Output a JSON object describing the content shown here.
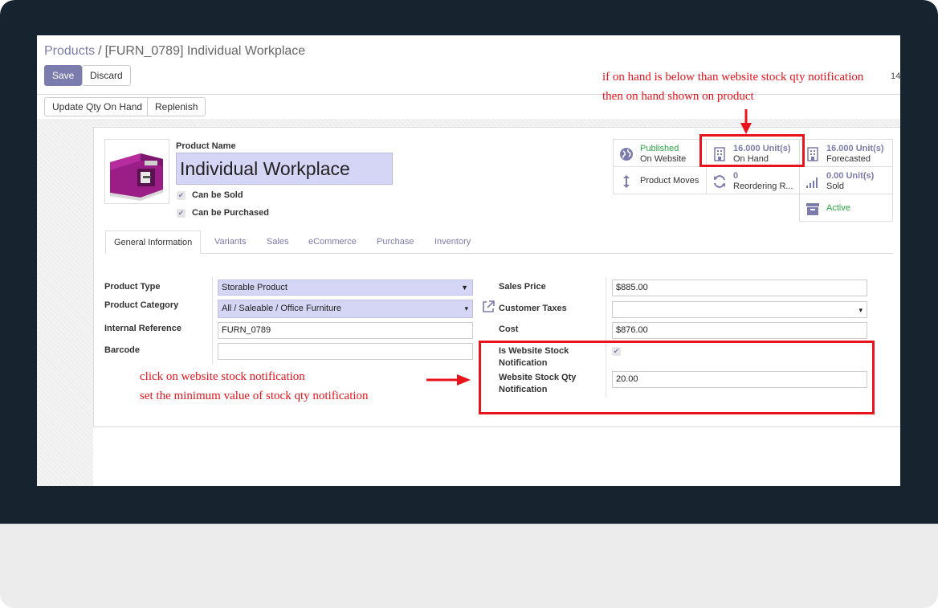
{
  "breadcrumb": {
    "parent": "Products",
    "separator": "/",
    "current": "[FURN_0789] Individual Workplace"
  },
  "toolbar": {
    "save_label": "Save",
    "discard_label": "Discard",
    "pager_fragment": "14"
  },
  "actions": {
    "update_qty_label": "Update Qty On Hand",
    "replenish_label": "Replenish"
  },
  "product": {
    "name_label": "Product Name",
    "name": "Individual Workplace",
    "can_be_sold_label": "Can be Sold",
    "can_be_sold": true,
    "can_be_purchased_label": "Can be Purchased",
    "can_be_purchased": true
  },
  "smart_buttons": {
    "published": {
      "line1": "Published",
      "line2": "On Website",
      "icon": "globe-icon"
    },
    "on_hand": {
      "line1": "16.000 Unit(s)",
      "line2": "On Hand",
      "icon": "building-icon"
    },
    "forecasted": {
      "line1": "16.000 Unit(s)",
      "line2": "Forecasted",
      "icon": "building-icon"
    },
    "product_moves": {
      "label": "Product Moves",
      "icon": "arrows-vertical-icon"
    },
    "reordering": {
      "line1": "0",
      "line2": "Reordering R...",
      "icon": "refresh-icon"
    },
    "sold": {
      "line1": "0.00 Unit(s)",
      "line2": "Sold",
      "icon": "signal-icon"
    },
    "active": {
      "label": "Active",
      "icon": "archive-icon"
    }
  },
  "tabs": [
    {
      "label": "General Information",
      "active": true
    },
    {
      "label": "Variants"
    },
    {
      "label": "Sales"
    },
    {
      "label": "eCommerce"
    },
    {
      "label": "Purchase"
    },
    {
      "label": "Inventory"
    }
  ],
  "left_fields": {
    "product_type": {
      "label": "Product Type",
      "value": "Storable Product"
    },
    "product_category": {
      "label": "Product Category",
      "value": "All / Saleable / Office Furniture"
    },
    "internal_reference": {
      "label": "Internal Reference",
      "value": "FURN_0789"
    },
    "barcode": {
      "label": "Barcode",
      "value": ""
    }
  },
  "right_fields": {
    "sales_price": {
      "label": "Sales Price",
      "value": "$885.00"
    },
    "customer_taxes": {
      "label": "Customer Taxes",
      "value": ""
    },
    "cost": {
      "label": "Cost",
      "value": "$876.00"
    },
    "website_stock_notification": {
      "label_line1": "Is Website Stock",
      "label_line2": "Notification",
      "checked": true
    },
    "website_stock_qty": {
      "label_line1": "Website Stock Qty",
      "label_line2": "Notification",
      "value": "20.00"
    }
  },
  "annotations": {
    "top_line1": "if on hand is below than website stock qty notification",
    "top_line2": "then on hand shown on product",
    "left_line1": "click on website stock notification",
    "left_line2": "set the minimum value of stock qty notification"
  },
  "colors": {
    "primary": "#7c7bad",
    "highlight": "#e8131b",
    "success": "#28a745",
    "required_bg": "#d5d5f5",
    "bezel": "#172430"
  }
}
